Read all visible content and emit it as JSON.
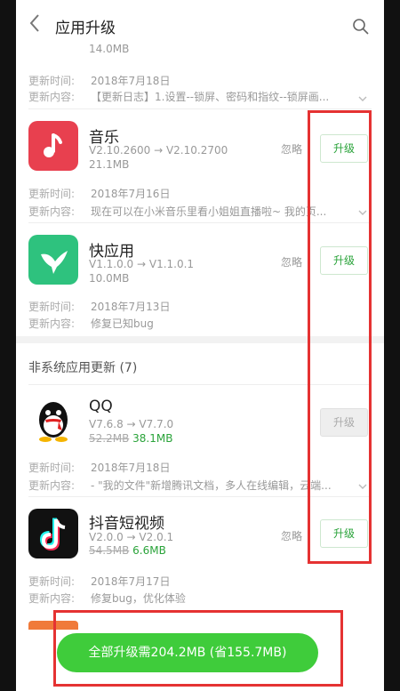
{
  "header": {
    "title": "应用升级"
  },
  "first_partial": {
    "size": "14.0MB",
    "time_label": "更新时间:",
    "time_value": "2018年7月18日",
    "content_label": "更新内容:",
    "content_value": "【更新日志】1.设置--锁屏、密码和指纹--锁屏画..."
  },
  "system_apps": [
    {
      "name": "音乐",
      "version": "V2.10.2600 → V2.10.2700",
      "size": "21.1MB",
      "ignore": "忽略",
      "button": "升级",
      "time_label": "更新时间:",
      "time_value": "2018年7月16日",
      "content_label": "更新内容:",
      "content_value": "现在可以在小米音乐里看小姐姐直播啦~ 我的页..."
    },
    {
      "name": "快应用",
      "version": "V1.1.0.0 → V1.1.0.1",
      "size": "10.0MB",
      "ignore": "忽略",
      "button": "升级",
      "time_label": "更新时间:",
      "time_value": "2018年7月13日",
      "content_label": "更新内容:",
      "content_value": "修复已知bug"
    }
  ],
  "section_title": "非系统应用更新 (7)",
  "third_apps": [
    {
      "name": "QQ",
      "version": "V7.6.8 → V7.7.0",
      "old_size": "52.2MB",
      "new_size": "38.1MB",
      "button": "升级",
      "time_label": "更新时间:",
      "time_value": "2018年7月18日",
      "content_label": "更新内容:",
      "content_value": "- \"我的文件\"新增腾讯文档，多人在线编辑，云端..."
    },
    {
      "name": "抖音短视频",
      "version": "V2.0.0 → V2.0.1",
      "old_size": "54.5MB",
      "new_size": "6.6MB",
      "ignore": "忽略",
      "button": "升级",
      "time_label": "更新时间:",
      "time_value": "2018年7月17日",
      "content_label": "更新内容:",
      "content_value": "修复bug，优化体验"
    }
  ],
  "upgrade_all": "全部升级需204.2MB (省155.7MB)",
  "colors": {
    "accent": "#3fcc3b",
    "annotation": "#e53232",
    "music": "#e8404f",
    "quickapp": "#2ec27e"
  }
}
